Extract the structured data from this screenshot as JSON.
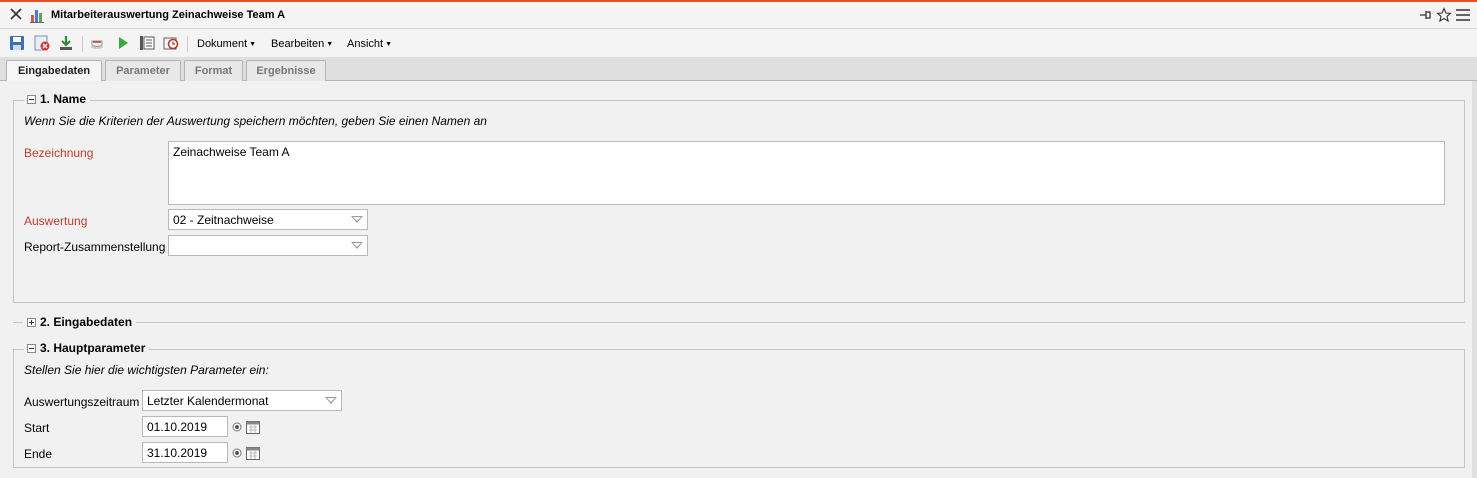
{
  "window": {
    "title": "Mitarbeiterauswertung Zeinachweise Team A"
  },
  "toolbar": {
    "icons": [
      "save-icon",
      "discard-icon",
      "download-icon",
      "coffee-icon",
      "run-icon",
      "list-icon",
      "report-icon"
    ],
    "menus": {
      "dokument": "Dokument",
      "bearbeiten": "Bearbeiten",
      "ansicht": "Ansicht"
    }
  },
  "tabs": {
    "eingabedaten": "Eingabedaten",
    "parameter": "Parameter",
    "format": "Format",
    "ergebnisse": "Ergebnisse",
    "active": "Eingabedaten"
  },
  "section_name": {
    "legend": "1. Name",
    "hint": "Wenn Sie die Kriterien der Auswertung speichern möchten, geben Sie einen Namen an",
    "bezeichnung_label": "Bezeichnung",
    "bezeichnung_value": "Zeinachweise Team A",
    "auswertung_label": "Auswertung",
    "auswertung_value": "02 - Zeitnachweise",
    "report_label": "Report-Zusammenstellung",
    "report_value": ""
  },
  "section_eingabedaten": {
    "legend": "2. Eingabedaten"
  },
  "section_hauptparameter": {
    "legend": "3. Hauptparameter",
    "hint": "Stellen Sie hier die wichtigsten Parameter ein:",
    "zeitraum_label": "Auswertungszeitraum",
    "zeitraum_value": "Letzter Kalendermonat",
    "start_label": "Start",
    "start_value": "01.10.2019",
    "ende_label": "Ende",
    "ende_value": "31.10.2019"
  },
  "colors": {
    "accent_line": "#e3512a",
    "required_label": "#c0392b"
  }
}
